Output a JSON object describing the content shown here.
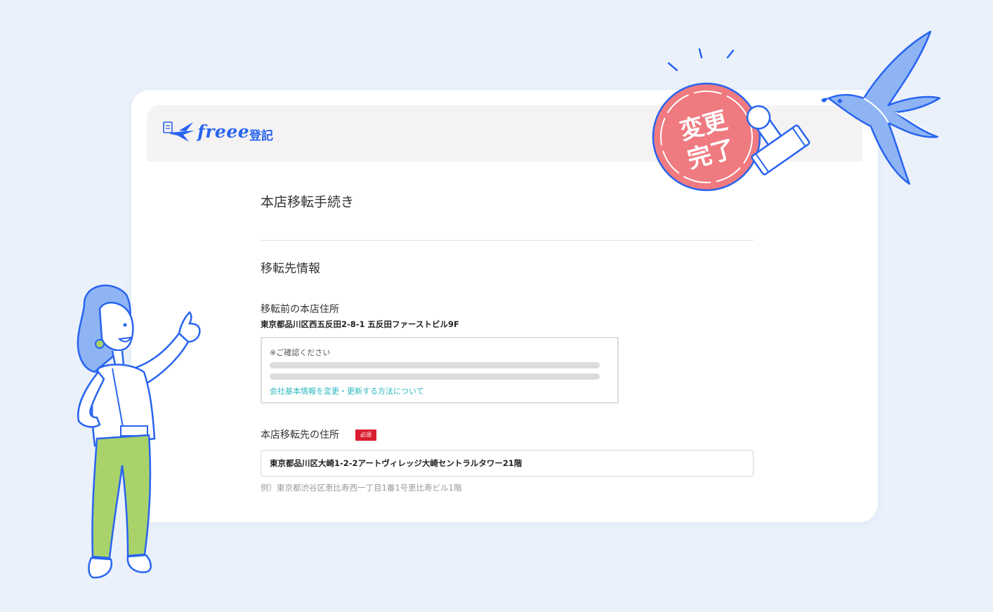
{
  "app": {
    "logo_text": "freee",
    "logo_sub": "登記"
  },
  "page": {
    "title": "本店移転手続き",
    "section_title": "移転先情報"
  },
  "previous_address": {
    "label": "移転前の本店住所",
    "value": "東京都品川区西五反田2-8-1 五反田ファーストビル9F"
  },
  "notice": {
    "label": "※ご確認ください",
    "link": "会社基本情報を変更・更新する方法について"
  },
  "new_address": {
    "label": "本店移転先の住所",
    "required_badge": "必須",
    "value": "東京都品川区大崎1-2-2アートヴィレッジ大崎セントラルタワー21階",
    "example": "例）東京都渋谷区恵比寿西一丁目1番1号恵比寿ビル1階"
  },
  "stamp": {
    "line1": "変更",
    "line2": "完了"
  },
  "colors": {
    "background": "#eaf1fb",
    "brand_blue": "#2864f0",
    "link_teal": "#2ab8bf",
    "required_red": "#d91c2e",
    "stamp_red": "#ef7a80",
    "pants_green": "#a9d36a"
  },
  "icons": [
    "freee-bird-logo-icon",
    "stamp-icon",
    "swallow-bird-icon",
    "woman-thumbs-up-illustration"
  ]
}
